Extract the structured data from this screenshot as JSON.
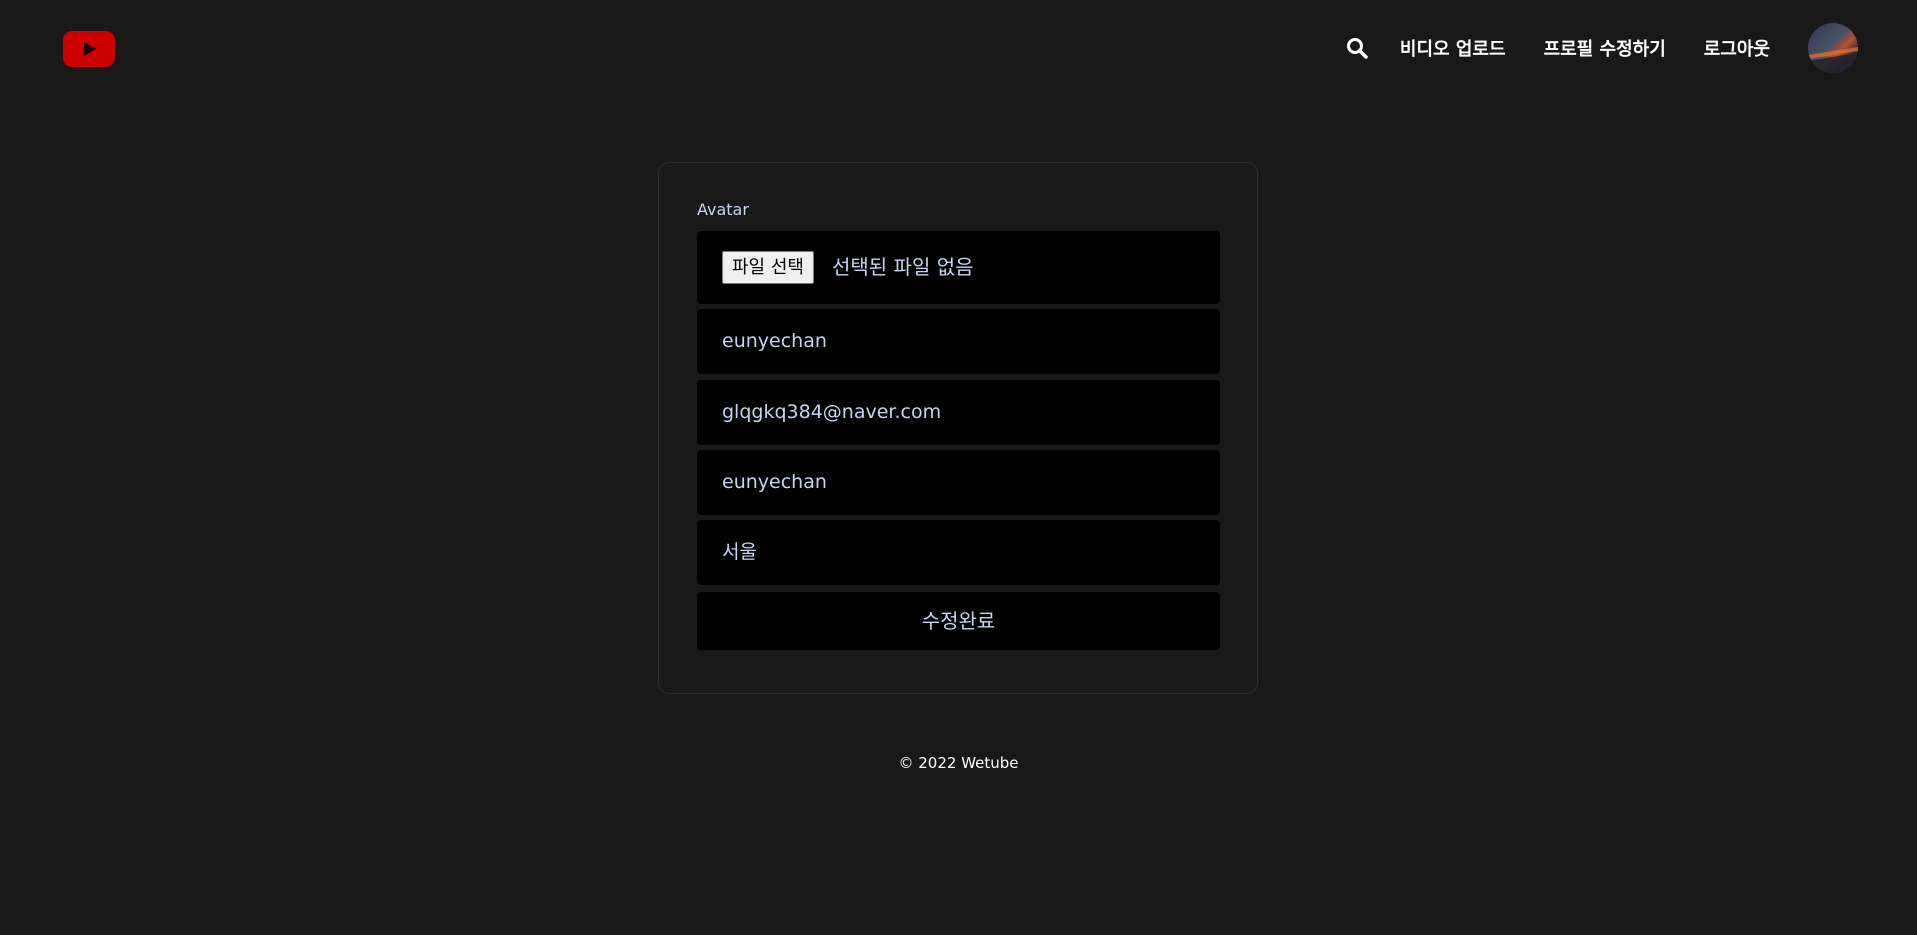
{
  "header": {
    "logo_icon": "youtube-play-icon",
    "logo_color": "#cc0000",
    "search_icon": "search-icon",
    "nav_links": [
      "비디오 업로드",
      "프로필 수정하기",
      "로그아웃"
    ],
    "avatar_image": "user-avatar"
  },
  "form": {
    "avatar_label": "Avatar",
    "file_button_label": "파일 선택",
    "file_status": "선택된 파일 없음",
    "name_value": "eunyechan",
    "email_value": "glqgkq384@naver.com",
    "username_value": "eunyechan",
    "location_value": "서울",
    "submit_label": "수정완료"
  },
  "footer": {
    "text": "© 2022 Wetube"
  },
  "colors": {
    "background": "#181818",
    "field_background": "#000000",
    "field_text": "#c9d4f2",
    "brand": "#cc0000"
  }
}
